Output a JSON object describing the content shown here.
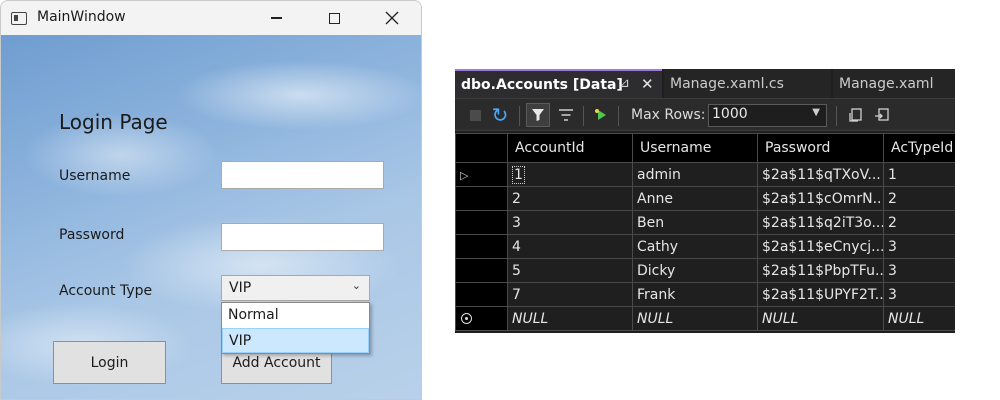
{
  "wpf": {
    "window_title": "MainWindow",
    "page_title": "Login Page",
    "username_label": "Username",
    "password_label": "Password",
    "account_type_label": "Account Type",
    "username_value": "",
    "password_value": "",
    "account_type_selected": "VIP",
    "account_type_options": [
      "Normal",
      "VIP"
    ],
    "login_button": "Login",
    "add_account_button": "Add Account"
  },
  "vs": {
    "tabs": [
      "dbo.Accounts [Data]",
      "Manage.xaml.cs",
      "Manage.xaml"
    ],
    "max_rows_label": "Max Rows:",
    "max_rows_value": "1000",
    "columns": [
      "AccountId",
      "Username",
      "Password",
      "AcTypeId"
    ],
    "rows": [
      [
        "1",
        "admin",
        "$2a$11$qTXoV...",
        "1"
      ],
      [
        "2",
        "Anne",
        "$2a$11$cOmrN...",
        "2"
      ],
      [
        "3",
        "Ben",
        "$2a$11$q2iT3o...",
        "2"
      ],
      [
        "4",
        "Cathy",
        "$2a$11$eCnycj...",
        "3"
      ],
      [
        "5",
        "Dicky",
        "$2a$11$PbpTFu...",
        "3"
      ],
      [
        "7",
        "Frank",
        "$2a$11$UPYF2T...",
        "3"
      ]
    ],
    "null_row": [
      "NULL",
      "NULL",
      "NULL",
      "NULL"
    ]
  },
  "colors": {
    "active_tab_accent": "#9c7cd8",
    "selection_blue": "#cce8ff"
  },
  "icons": [
    "app-icon",
    "minimize-icon",
    "maximize-icon",
    "close-icon",
    "pin-icon",
    "stop-icon",
    "refresh-icon",
    "filter-icon",
    "sort-icon",
    "run-script-icon",
    "export-icon"
  ]
}
